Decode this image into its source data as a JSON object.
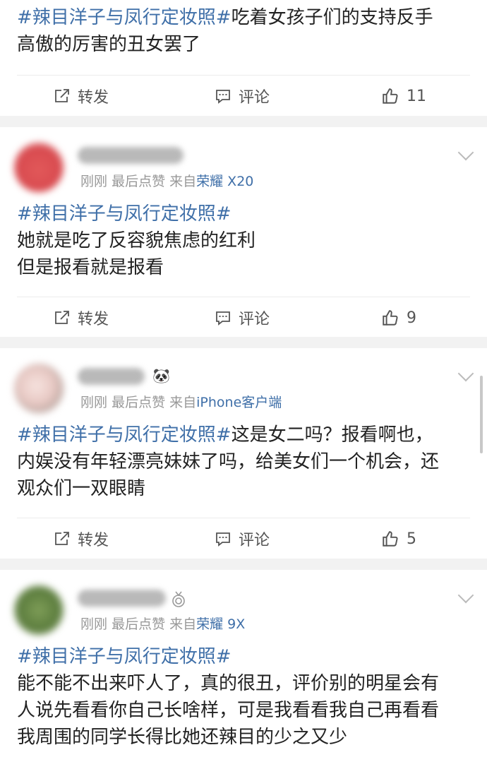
{
  "topic": "#辣目洋子与凤行定妆照#",
  "actions": {
    "repost": "转发",
    "comment": "评论"
  },
  "posts": [
    {
      "lines": [
        [
          "#辣目洋子与凤行定妆照#",
          "吃着女孩子们的支持反手"
        ],
        [
          "",
          "高傲的厉害的丑女罢了"
        ]
      ],
      "likes": "11"
    },
    {
      "meta": {
        "time": "刚刚",
        "last": "最后点赞",
        "from": "来自",
        "source": "荣耀 X20"
      },
      "lines": [
        [
          "#辣目洋子与凤行定妆照#",
          ""
        ],
        [
          "",
          "她就是吃了反容貌焦虑的红利"
        ],
        [
          "",
          "但是报看就是报看"
        ]
      ],
      "likes": "9"
    },
    {
      "meta": {
        "time": "刚刚",
        "last": "最后点赞",
        "from": "来自",
        "source": "iPhone客户端"
      },
      "badge": "🐼",
      "lines": [
        [
          "#辣目洋子与凤行定妆照#",
          "这是女二吗？报看啊也，"
        ],
        [
          "",
          "内娱没有年轻漂亮妹妹了吗，给美女们一个机会，还"
        ],
        [
          "",
          "观众们一双眼睛"
        ]
      ],
      "likes": "5"
    },
    {
      "meta": {
        "time": "刚刚",
        "last": "最后点赞",
        "from": "来自",
        "source": "荣耀 9X"
      },
      "lines": [
        [
          "#辣目洋子与凤行定妆照#",
          ""
        ],
        [
          "",
          "能不能不出来吓人了，真的很丑，评价别的明星会有"
        ],
        [
          "",
          "人说先看看你自己长啥样，可是我看看我自己再看看"
        ],
        [
          "",
          "我周围的同学长得比她还辣目的少之又少"
        ]
      ]
    }
  ],
  "colors": {
    "link": "#3f6fa8",
    "meta": "#999999",
    "text": "#222222",
    "separator": "#f2f2f2"
  },
  "icons": {
    "repost": "share-square-icon",
    "comment": "comment-bubble-icon",
    "like": "thumbs-up-icon",
    "more": "chevron-down-icon"
  }
}
